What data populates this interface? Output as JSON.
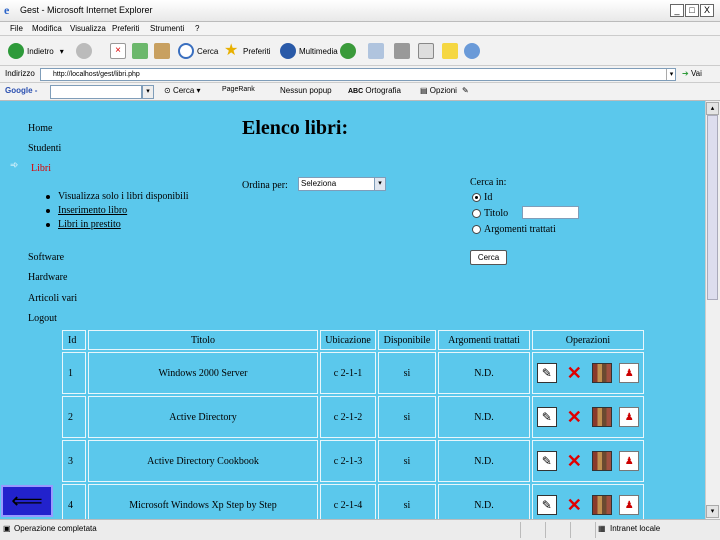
{
  "window": {
    "title": "Gest - Microsoft Internet Explorer",
    "min": "_",
    "max": "□",
    "close": "X"
  },
  "menu": [
    "File",
    "Modifica",
    "Visualizza",
    "Preferiti",
    "Strumenti",
    "?"
  ],
  "toolbar": {
    "back": "Indietro",
    "search": "Cerca",
    "favorites": "Preferiti",
    "multimedia": "Multimedia"
  },
  "address": {
    "label": "Indirizzo",
    "url": "http://localhost/gest/libri.php",
    "go": "Vai"
  },
  "googlebar": {
    "label": "Google -",
    "search": "Cerca",
    "pagerank": "PageRank",
    "blocked": "Nessun popup",
    "spell": "Ortografia",
    "options": "Opzioni"
  },
  "nav": {
    "home": "Home",
    "students": "Studenti",
    "books": "Libri",
    "sub": [
      "Visualizza solo i libri disponibili",
      "Inserimento libro",
      "Libri in prestito"
    ],
    "software": "Software",
    "hardware": "Hardware",
    "misc": "Articoli vari",
    "logout": "Logout"
  },
  "page": {
    "title": "Elenco libri:"
  },
  "order": {
    "label": "Ordina per:",
    "selected": "Seleziona"
  },
  "search": {
    "label": "Cerca in:",
    "options": [
      "Id",
      "Titolo",
      "Argomenti trattati"
    ],
    "button": "Cerca"
  },
  "table": {
    "headers": [
      "Id",
      "Titolo",
      "Ubicazione",
      "Disponibile",
      "Argomenti trattati",
      "Operazioni"
    ],
    "rows": [
      {
        "id": "1",
        "title": "Windows 2000 Server",
        "location": "c 2-1-1",
        "available": "si",
        "topics": "N.D."
      },
      {
        "id": "2",
        "title": "Active Directory",
        "location": "c 2-1-2",
        "available": "si",
        "topics": "N.D."
      },
      {
        "id": "3",
        "title": "Active Directory Cookbook",
        "location": "c 2-1-3",
        "available": "si",
        "topics": "N.D."
      },
      {
        "id": "4",
        "title": "Microsoft Windows Xp Step by Step",
        "location": "c 2-1-4",
        "available": "si",
        "topics": "N.D."
      }
    ]
  },
  "status": {
    "text": "Operazione completata",
    "zone": "Intranet locale"
  },
  "colors": {
    "content_bg": "#5bc8ec",
    "active_nav": "#dd0000",
    "delete": "#e00000"
  }
}
